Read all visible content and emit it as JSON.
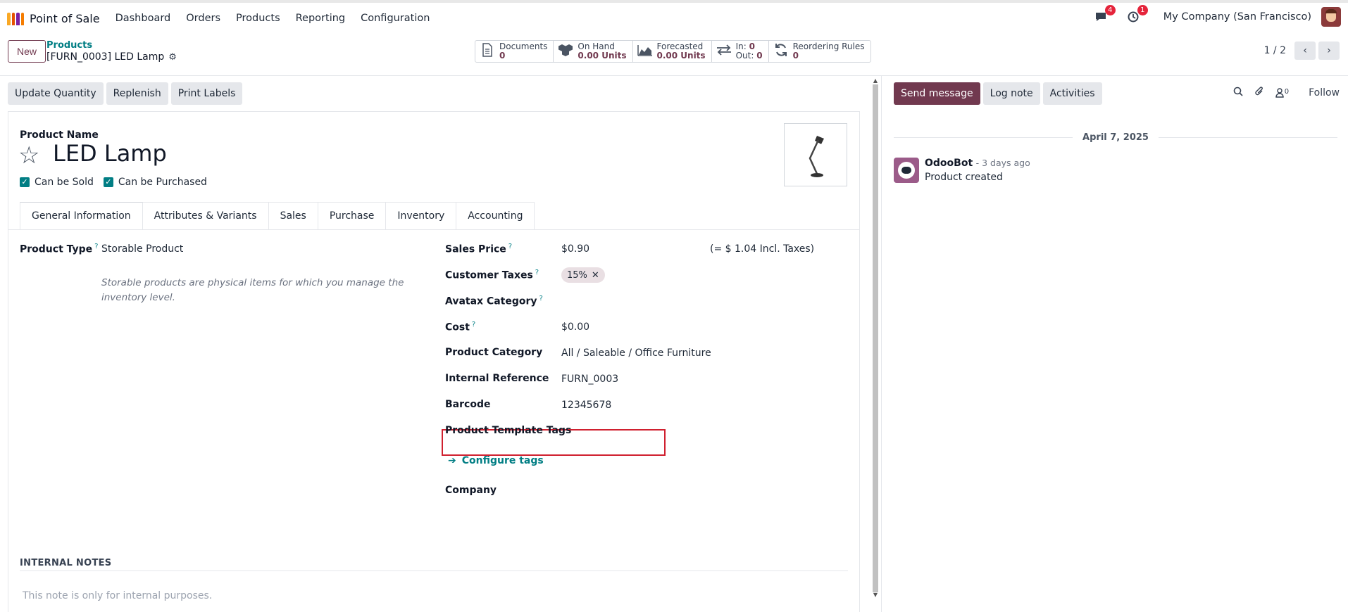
{
  "nav": {
    "app_name": "Point of Sale",
    "menu": [
      "Dashboard",
      "Orders",
      "Products",
      "Reporting",
      "Configuration"
    ],
    "messages_badge": "4",
    "activities_badge": "1",
    "company": "My Company (San Francisco)"
  },
  "control": {
    "new_label": "New",
    "breadcrumb": "Products",
    "record_name": "[FURN_0003] LED Lamp",
    "smart_buttons": [
      {
        "icon": "document-icon",
        "label": "Documents",
        "value": "0"
      },
      {
        "icon": "cubes-icon",
        "label": "On Hand",
        "value": "0.00 Units"
      },
      {
        "icon": "area-chart-icon",
        "label": "Forecasted",
        "value": "0.00 Units"
      },
      {
        "icon": "exchange-icon",
        "label": "In:",
        "value": "0",
        "label2": "Out:",
        "value2": "0"
      },
      {
        "icon": "refresh-icon",
        "label": "Reordering Rules",
        "value": "0"
      }
    ],
    "pager": "1 / 2"
  },
  "actions": [
    "Update Quantity",
    "Replenish",
    "Print Labels"
  ],
  "form": {
    "product_name_label": "Product Name",
    "product_name": "LED Lamp",
    "can_be_sold": "Can be Sold",
    "can_be_purchased": "Can be Purchased",
    "tabs": [
      "General Information",
      "Attributes & Variants",
      "Sales",
      "Purchase",
      "Inventory",
      "Accounting"
    ],
    "product_type_label": "Product Type",
    "product_type": "Storable Product",
    "product_type_help": "Storable products are physical items for which you manage the inventory level.",
    "sales_price_label": "Sales Price",
    "sales_price": "$0.90",
    "incl_taxes": "(= $ 1.04 Incl. Taxes)",
    "customer_taxes_label": "Customer Taxes",
    "customer_tax_tag": "15%",
    "avatax_label": "Avatax Category",
    "cost_label": "Cost",
    "cost": "$0.00",
    "category_label": "Product Category",
    "category": "All / Saleable / Office Furniture",
    "internal_ref_label": "Internal Reference",
    "internal_ref": "FURN_0003",
    "barcode_label": "Barcode",
    "barcode": "12345678",
    "template_tags_label": "Product Template Tags",
    "configure_tags": "Configure tags",
    "company_label": "Company",
    "notes_title": "INTERNAL NOTES",
    "notes_placeholder": "This note is only for internal purposes."
  },
  "chatter": {
    "send_message": "Send message",
    "log_note": "Log note",
    "activities": "Activities",
    "followers_count": "0",
    "follow": "Follow",
    "date": "April 7, 2025",
    "author": "OdooBot",
    "ago": "- 3 days ago",
    "body": "Product created"
  },
  "colors": {
    "primary": "#71394f",
    "link": "#017e84",
    "highlight": "#d0202f"
  }
}
